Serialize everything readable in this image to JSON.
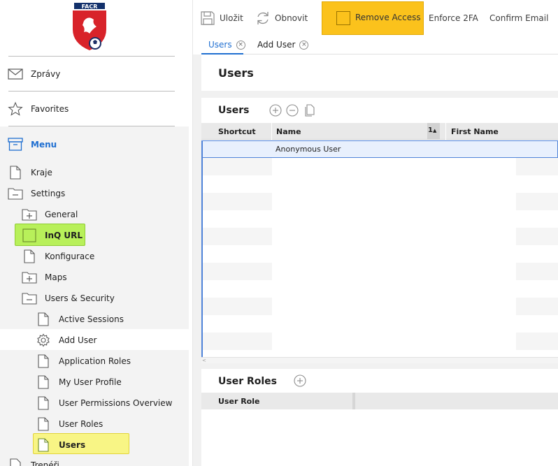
{
  "toolbar": {
    "save_label": "Uložit",
    "refresh_label": "Obnovit",
    "remove_access_label": "Remove Access",
    "enforce_2fa_label": "Enforce 2FA",
    "confirm_email_label": "Confirm Email"
  },
  "tabs": [
    {
      "label": "Users",
      "active": true
    },
    {
      "label": "Add User",
      "active": false
    }
  ],
  "sidebar": {
    "logo_text": "FACR",
    "messages_label": "Zprávy",
    "favorites_label": "Favorites",
    "menu_label": "Menu",
    "items": [
      {
        "label": "Kraje",
        "icon": "document-icon"
      },
      {
        "label": "Settings",
        "icon": "folder-open-icon"
      },
      {
        "label": "General",
        "icon": "folder-plus-icon"
      },
      {
        "label": "InQ URL",
        "icon": "checkbox-icon"
      },
      {
        "label": "Konfigurace",
        "icon": "document-icon"
      },
      {
        "label": "Maps",
        "icon": "folder-plus-icon"
      },
      {
        "label": "Users & Security",
        "icon": "folder-open-icon"
      },
      {
        "label": "Active Sessions",
        "icon": "document-icon"
      },
      {
        "label": "Add User",
        "icon": "gear-icon"
      },
      {
        "label": "Application Roles",
        "icon": "document-icon"
      },
      {
        "label": "My User Profile",
        "icon": "document-icon"
      },
      {
        "label": "User Permissions Overview",
        "icon": "document-icon"
      },
      {
        "label": "User Roles",
        "icon": "document-icon"
      },
      {
        "label": "Users",
        "icon": "document-icon"
      },
      {
        "label": "Trenéři",
        "icon": "document-icon"
      }
    ]
  },
  "page": {
    "title": "Users"
  },
  "users_grid": {
    "title": "Users",
    "columns": [
      "Shortcut",
      "Name",
      "First Name"
    ],
    "sort_indicator": "1",
    "rows": [
      {
        "shortcut": "",
        "name": "Anonymous User",
        "first_name": ""
      }
    ],
    "scroll_left_glyph": "<"
  },
  "user_roles": {
    "title": "User Roles",
    "columns": [
      "User Role"
    ]
  },
  "colors": {
    "accent_blue": "#1f6fd1",
    "highlight_yellow": "#fbc21c",
    "highlight_green": "#b8f05a",
    "highlight_light_yellow": "#f8f585"
  }
}
